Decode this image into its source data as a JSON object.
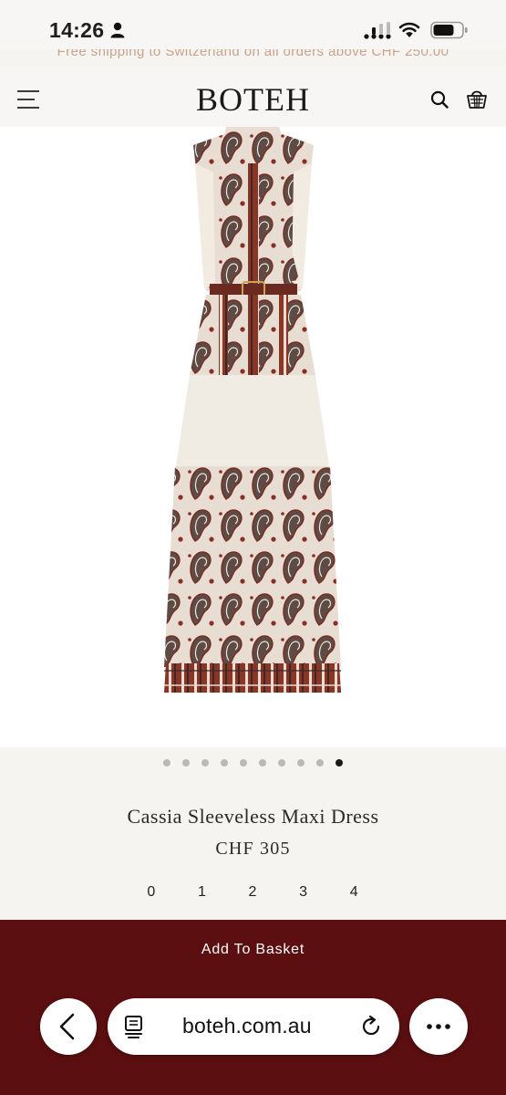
{
  "status_bar": {
    "time": "14:26"
  },
  "promo": {
    "text": "Free shipping to Switzerland on all orders above CHF 250.00"
  },
  "header": {
    "logo": "BOTEH",
    "icons": [
      "menu-icon",
      "search-icon",
      "basket-icon"
    ]
  },
  "gallery": {
    "slide_count": 10,
    "active_index": 9
  },
  "product": {
    "title": "Cassia Sleeveless Maxi Dress",
    "price": "CHF 305",
    "sizes": [
      "0",
      "1",
      "2",
      "3",
      "4"
    ]
  },
  "basket": {
    "add_label": "Add To Basket"
  },
  "browser": {
    "url": "boteh.com.au"
  },
  "colors": {
    "accent": "#5b0f10",
    "promo_text": "#c9a38a",
    "page_bg": "#f5f4f1"
  }
}
